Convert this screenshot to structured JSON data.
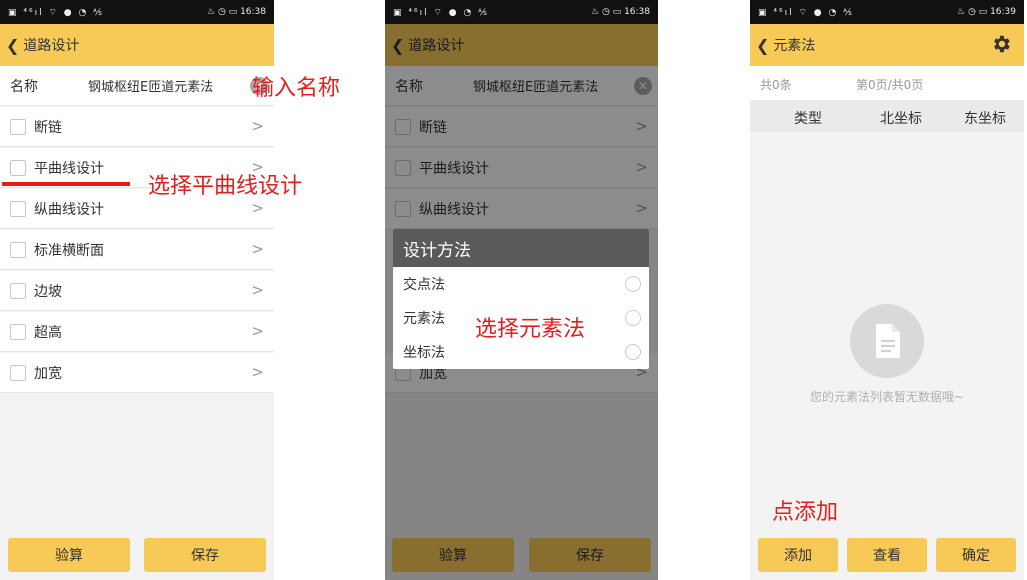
{
  "status_bar": {
    "icons_left": "▣ ⁴⁶ıl ⌔ ● ◔ ⅍",
    "icons_right": "♨ ◷ ▭",
    "time1": "16:38",
    "time2": "16:38",
    "time3": "16:39"
  },
  "screen1": {
    "back_icon": "chevron-left",
    "title": "道路设计",
    "name_label": "名称",
    "name_value": "钢城枢纽E匝道元素法",
    "items": [
      "断链",
      "平曲线设计",
      "纵曲线设计",
      "标准横断面",
      "边坡",
      "超高",
      "加宽"
    ],
    "buttons": {
      "check": "验算",
      "save": "保存"
    }
  },
  "screen2": {
    "title": "道路设计",
    "name_label": "名称",
    "name_value": "钢城枢纽E匝道元素法",
    "items": [
      "断链",
      "平曲线设计",
      "纵曲线设计"
    ],
    "hidden_item_fragment": "加宽",
    "dialog": {
      "title": "设计方法",
      "options": [
        "交点法",
        "元素法",
        "坐标法"
      ]
    },
    "buttons": {
      "check": "验算",
      "save": "保存"
    }
  },
  "screen3": {
    "title": "元素法",
    "total": "共0条",
    "page": "第0页/共0页",
    "columns": [
      "类型",
      "北坐标",
      "东坐标"
    ],
    "empty_text": "您的元素法列表暂无数据哦~",
    "buttons": {
      "add": "添加",
      "view": "查看",
      "confirm": "确定"
    }
  },
  "annotations": {
    "input_name": "输入名称",
    "select_curve": "选择平曲线设计",
    "select_element": "选择元素法",
    "click_add": "点添加"
  },
  "colors": {
    "accent": "#f7c957",
    "annotation": "#e02020"
  }
}
